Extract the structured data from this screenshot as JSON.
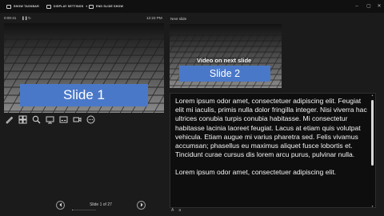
{
  "toolbar": {
    "show_taskbar": "SHOW TASKBAR",
    "display_settings": "DISPLAY SETTINGS",
    "end_slide_show": "END SLIDE SHOW"
  },
  "status": {
    "timer": "0:00:41",
    "clock": "12:22 PM",
    "next_slide_label": "Next slide"
  },
  "current_slide": {
    "title": "Slide 1"
  },
  "next_slide": {
    "title": "Slide 2",
    "video_note": "Video on next slide"
  },
  "navigation": {
    "slide_count": "Slide 1 of 27",
    "progress": 0.037
  },
  "notes": {
    "paragraphs": [
      "Lorem ipsum odor amet, consectetuer adipiscing elit. Feugiat elit mi iaculis, primis nulla dolor fringilla integer. Nisi viverra hac ultrices conubia turpis conubia habitasse. Mi consectetur habitasse lacinia laoreet feugiat. Lacus at etiam quis volutpat vehicula. Etiam augue mi varius pharetra sed. Felis vivamus accumsan; phasellus eu maximus aliquet fusce lobortis et. Tincidunt curae cursus dis lorem arcu purus, pulvinar nulla.",
      "Lorem ipsum odor amet, consectetuer adipiscing elit."
    ]
  },
  "colors": {
    "slide_title_bg": "#4a78c8",
    "background": "#1b1b1b"
  },
  "icons": [
    "pen-icon",
    "grid-icon",
    "zoom-icon",
    "display-icon",
    "subtitles-icon",
    "camera-icon",
    "more-icon"
  ]
}
